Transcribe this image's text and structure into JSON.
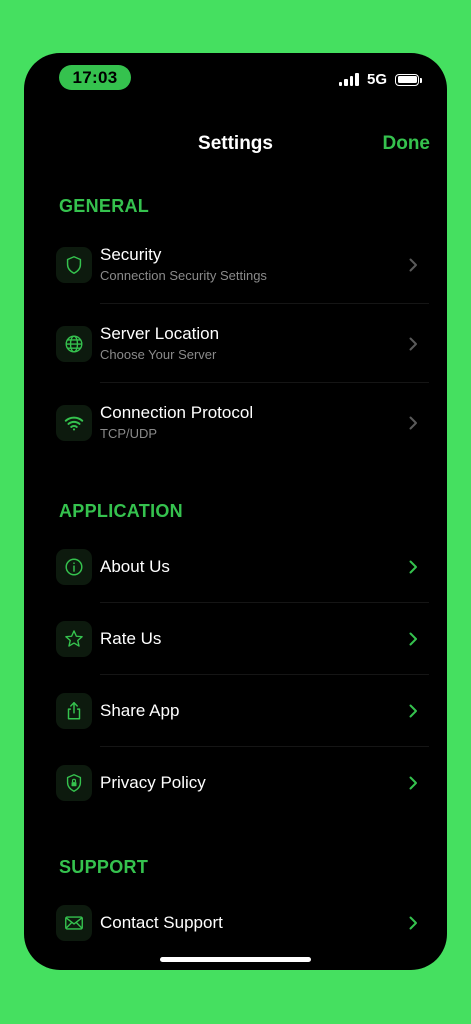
{
  "status_bar": {
    "time": "17:03",
    "network": "5G"
  },
  "nav": {
    "title": "Settings",
    "done_label": "Done"
  },
  "colors": {
    "accent": "#35c24e",
    "chevron_muted": "#5a5a5a",
    "background": "#000000",
    "frame": "#45e060"
  },
  "sections": {
    "general": {
      "header": "GENERAL",
      "items": [
        {
          "title": "Security",
          "subtitle": "Connection Security Settings",
          "icon": "shield-icon"
        },
        {
          "title": "Server Location",
          "subtitle": "Choose Your Server",
          "icon": "globe-icon"
        },
        {
          "title": "Connection Protocol",
          "subtitle": "TCP/UDP",
          "icon": "wifi-icon"
        }
      ]
    },
    "application": {
      "header": "APPLICATION",
      "items": [
        {
          "title": "About Us",
          "icon": "info-icon"
        },
        {
          "title": "Rate Us",
          "icon": "star-icon"
        },
        {
          "title": "Share App",
          "icon": "share-icon"
        },
        {
          "title": "Privacy Policy",
          "icon": "lock-shield-icon"
        }
      ]
    },
    "support": {
      "header": "SUPPORT",
      "items": [
        {
          "title": "Contact Support",
          "icon": "envelope-icon"
        }
      ]
    }
  }
}
